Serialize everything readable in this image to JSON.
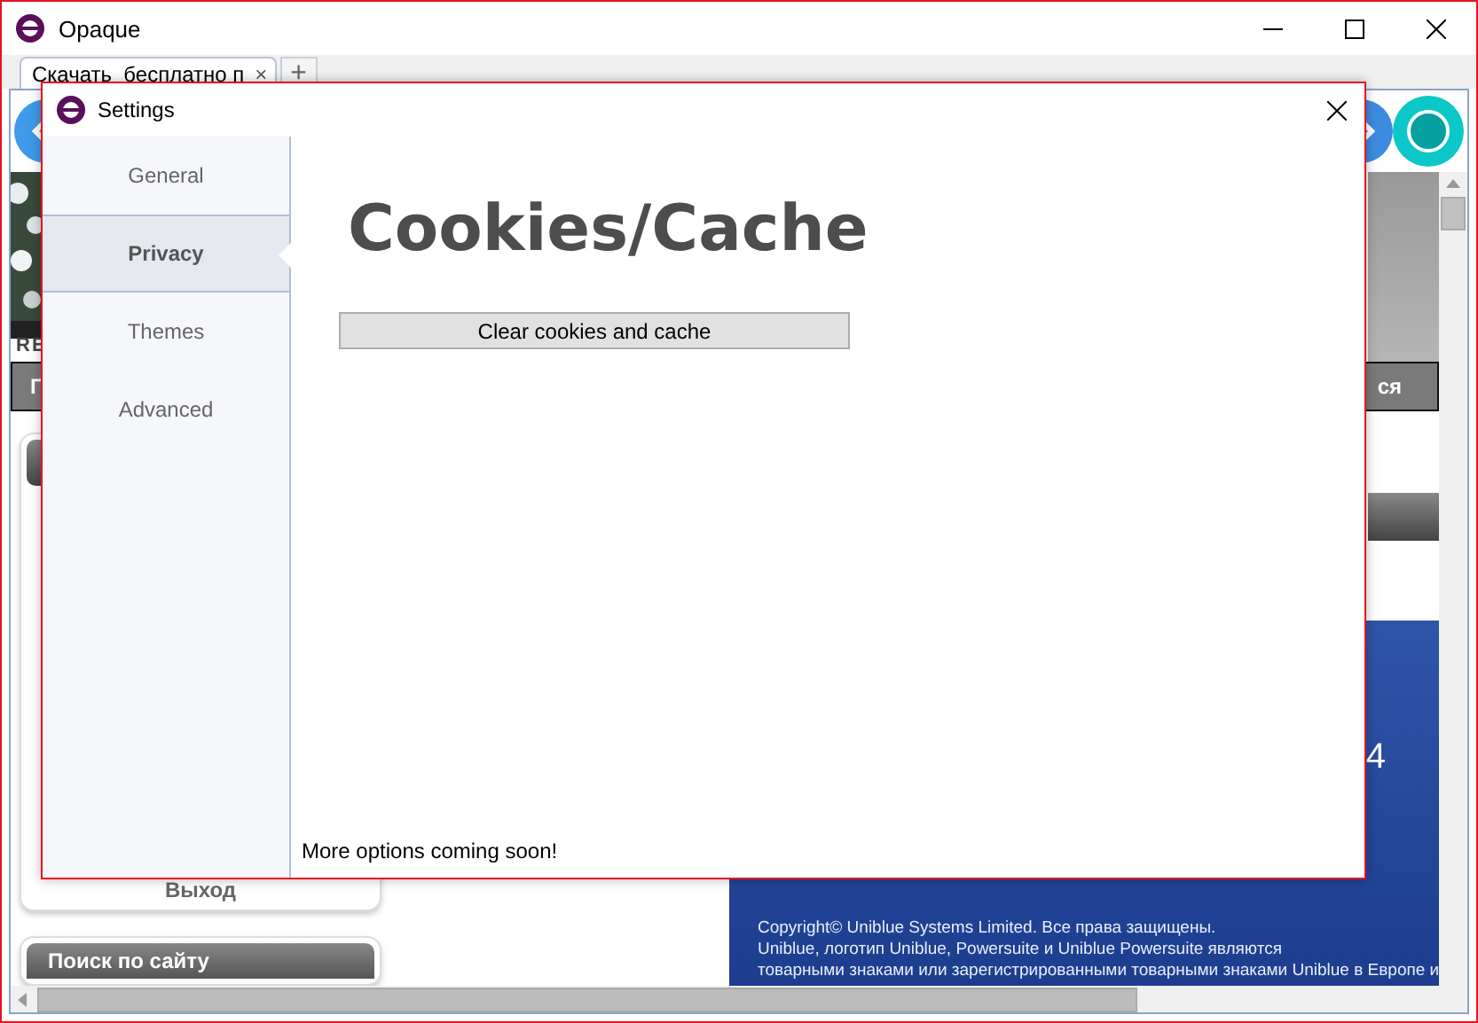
{
  "window": {
    "title": "Opaque"
  },
  "tabs": [
    {
      "label": "Скачать  бесплатно п",
      "selected": true,
      "close": "×"
    }
  ],
  "new_tab": "+",
  "page": {
    "banner_text": "RE",
    "nav_left": "Г",
    "nav_right": "ся",
    "logout": "Выход",
    "search_heading": "Поиск по сайту",
    "promo_text": "4",
    "copyright": [
      "Copyright© Uniblue Systems Limited. Все права защищены.",
      "Uniblue, логотип Uniblue, Powersuite и Uniblue Powersuite являются",
      "товарными знаками или зарегистрированными товарными знаками Uniblue в Европе и"
    ]
  },
  "settings": {
    "title": "Settings",
    "menu": [
      {
        "label": "General",
        "selected": false
      },
      {
        "label": "Privacy",
        "selected": true
      },
      {
        "label": "Themes",
        "selected": false
      },
      {
        "label": "Advanced",
        "selected": false
      }
    ],
    "heading": "Cookies/Cache",
    "button": "Clear cookies and cache",
    "footer": "More options coming soon!"
  }
}
